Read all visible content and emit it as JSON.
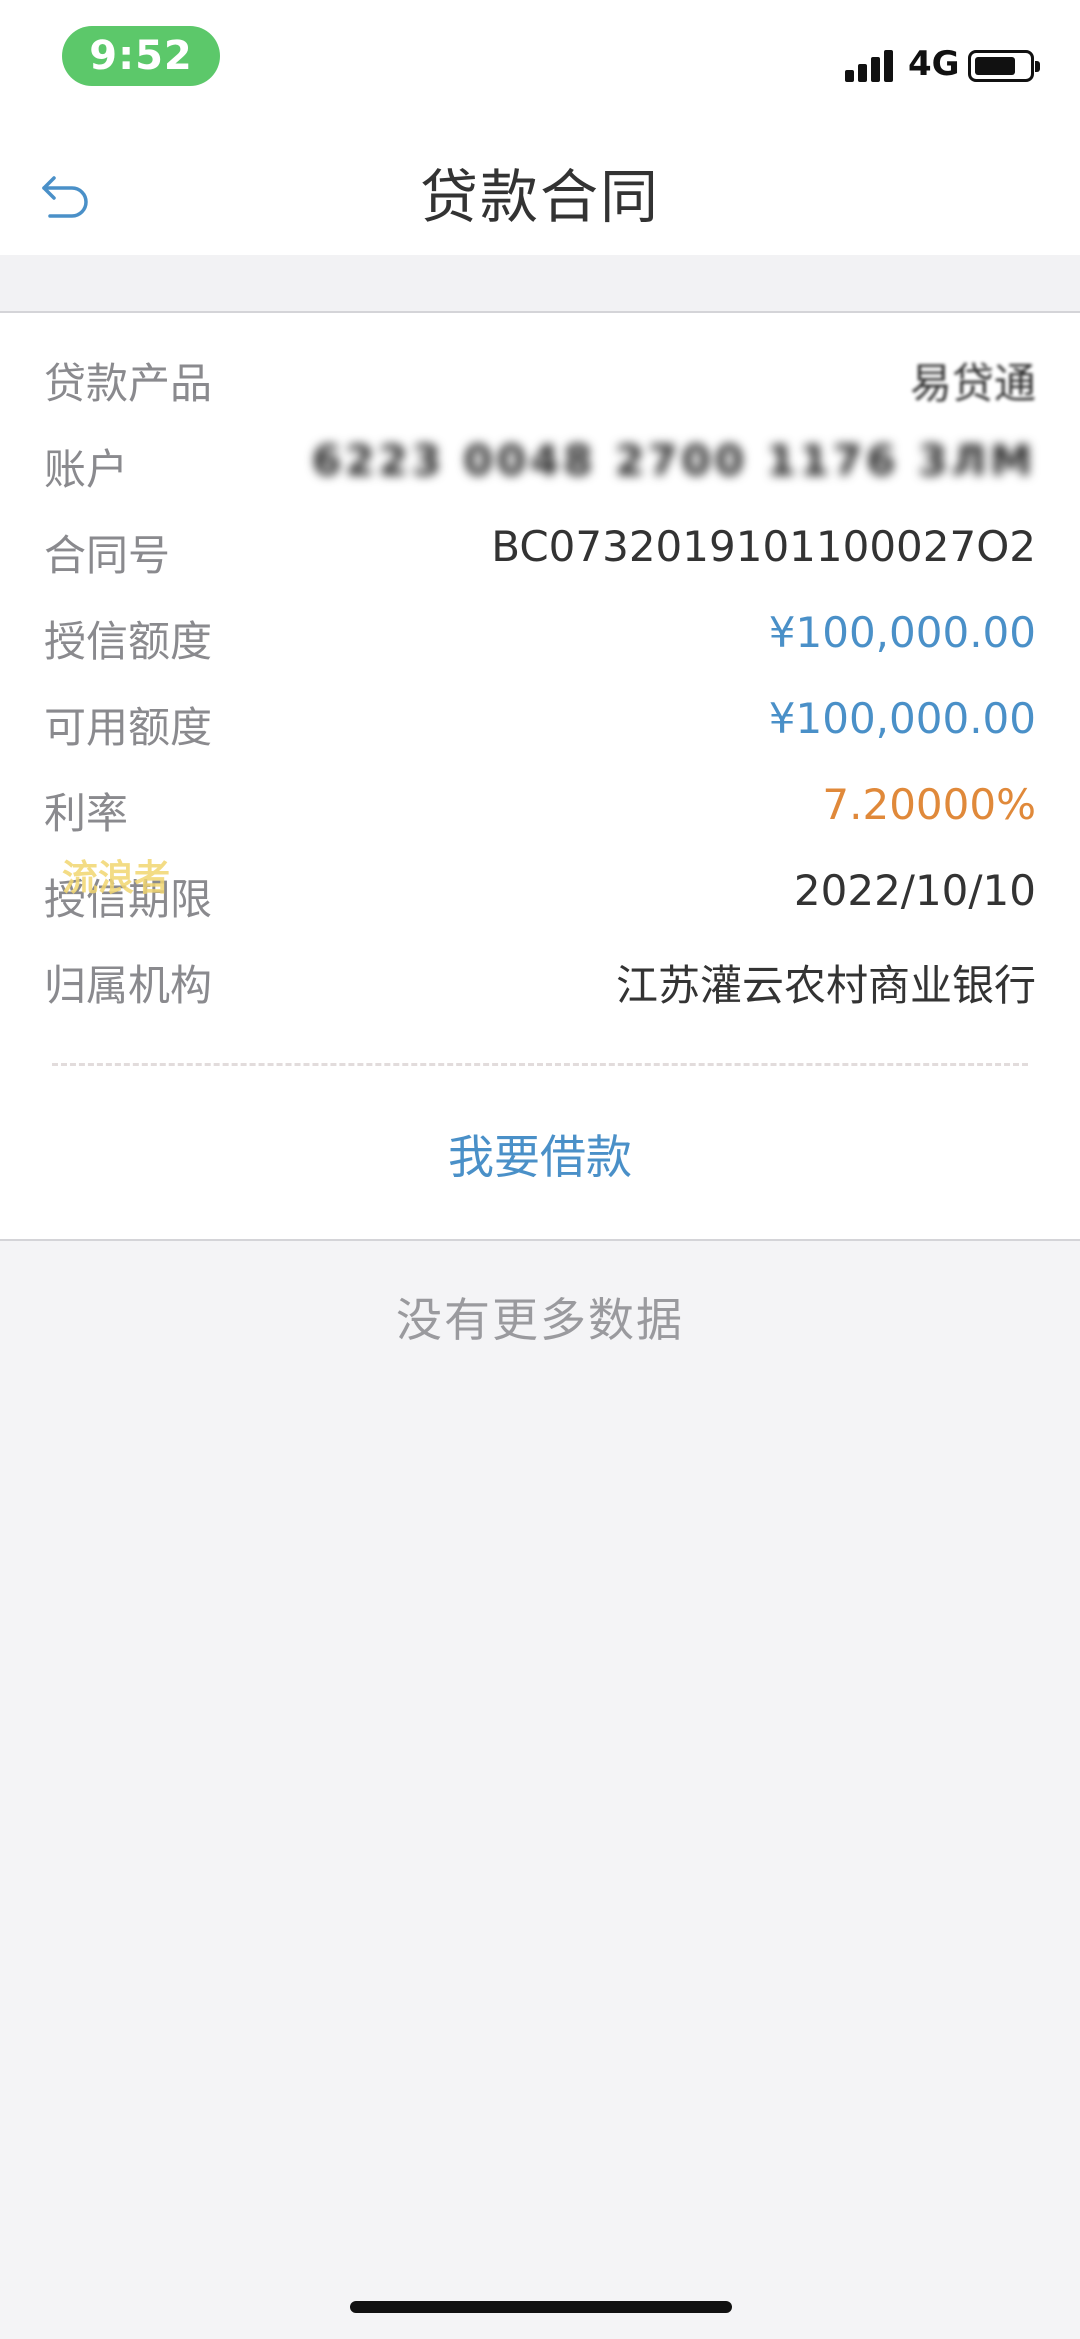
{
  "status_bar": {
    "time": "9:52",
    "network": "4G"
  },
  "nav": {
    "back_icon": "back-arrow-icon",
    "title": "贷款合同"
  },
  "contract": {
    "rows": [
      {
        "label": "贷款产品",
        "value": "易贷通"
      },
      {
        "label": "账户",
        "value": "6223 0048 2700 1176 3ЛМ"
      },
      {
        "label": "合同号",
        "value": "BC0732019101100027O2"
      },
      {
        "label": "授信额度",
        "value": "¥100,000.00"
      },
      {
        "label": "可用额度",
        "value": "¥100,000.00"
      },
      {
        "label": "利率",
        "value": "7.20000%"
      },
      {
        "label": "授信期限",
        "value": "2022/10/10"
      },
      {
        "label": "归属机构",
        "value": "江苏灌云农村商业银行"
      }
    ],
    "watermark": "流浪者",
    "action_label": "我要借款"
  },
  "footer": {
    "no_more": "没有更多数据"
  },
  "colors": {
    "accent_blue": "#4a90c8",
    "rate_orange": "#e0893a",
    "time_pill_green": "#5cc86a"
  }
}
